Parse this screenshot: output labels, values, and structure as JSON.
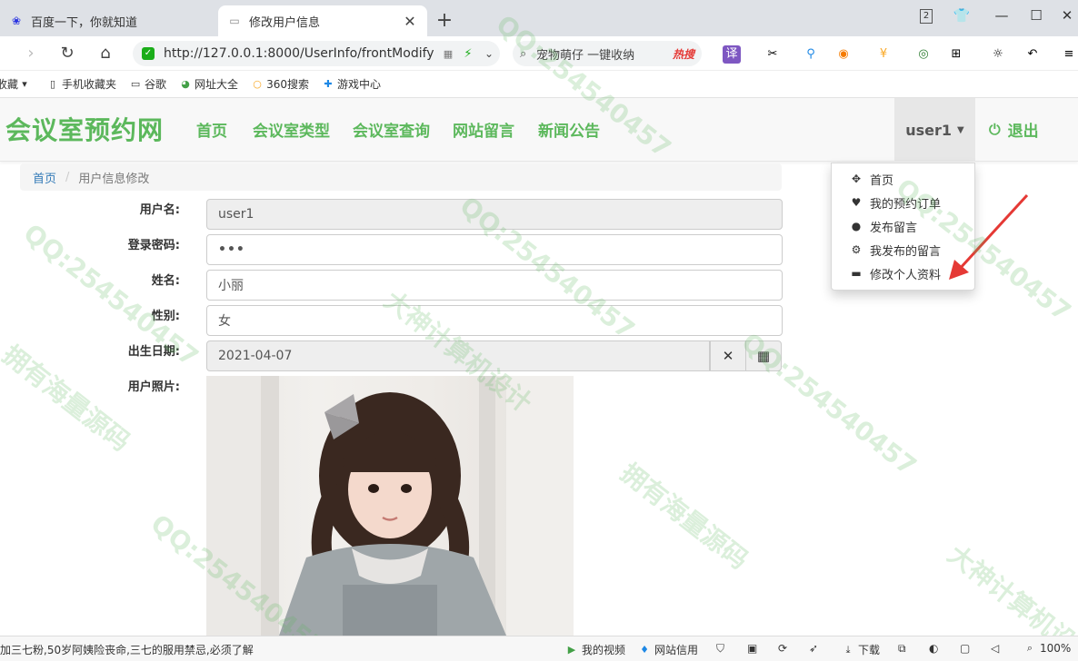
{
  "tabs": [
    {
      "label": "百度一下，你就知道",
      "icon": "baidu-paw-icon"
    },
    {
      "label": "修改用户信息",
      "icon": "page-icon"
    }
  ],
  "window": {
    "badge": "2"
  },
  "address": {
    "url": "http://127.0.0.1:8000/UserInfo/frontModify"
  },
  "search": {
    "text": "宠物萌仔 一键收纳",
    "hot": "热搜"
  },
  "bookmarks": [
    {
      "label": "收藏",
      "icon": "star-icon"
    },
    {
      "label": "手机收藏夹",
      "icon": "phone-icon"
    },
    {
      "label": "谷歌",
      "icon": "page-icon"
    },
    {
      "label": "网址大全",
      "icon": "globe-icon"
    },
    {
      "label": "360搜索",
      "icon": "search-icon"
    },
    {
      "label": "游戏中心",
      "icon": "game-icon"
    }
  ],
  "site": {
    "brand": "会议室预约网",
    "nav": [
      "首页",
      "会议室类型",
      "会议室查询",
      "网站留言",
      "新闻公告"
    ],
    "user": "user1",
    "logout": "退出"
  },
  "dropdown": [
    {
      "label": "首页",
      "icon": "move-icon"
    },
    {
      "label": "我的预约订单",
      "icon": "heart-icon"
    },
    {
      "label": "发布留言",
      "icon": "user-icon"
    },
    {
      "label": "我发布的留言",
      "icon": "cog-icon"
    },
    {
      "label": "修改个人资料",
      "icon": "credit-card-icon"
    }
  ],
  "breadcrumb": {
    "home": "首页",
    "current": "用户信息修改"
  },
  "form": {
    "username_label": "用户名:",
    "username": "user1",
    "password_label": "登录密码:",
    "password": "•••",
    "name_label": "姓名:",
    "name": "小丽",
    "gender_label": "性别:",
    "gender": "女",
    "birth_label": "出生日期:",
    "birth": "2021-04-07",
    "photo_label": "用户照片:"
  },
  "status": {
    "news": "加三七粉,50岁阿姨险丧命,三七的服用禁忌,必须了解",
    "items": [
      "我的视频",
      "网站信用",
      "下载",
      "100%"
    ]
  },
  "watermark": {
    "texts": [
      "QQ:254540457",
      "大神计算机设计",
      "拥有海量源码"
    ]
  },
  "colors": {
    "brand": "#5cb85c",
    "link": "#337ab7",
    "arrow": "#e53935"
  }
}
